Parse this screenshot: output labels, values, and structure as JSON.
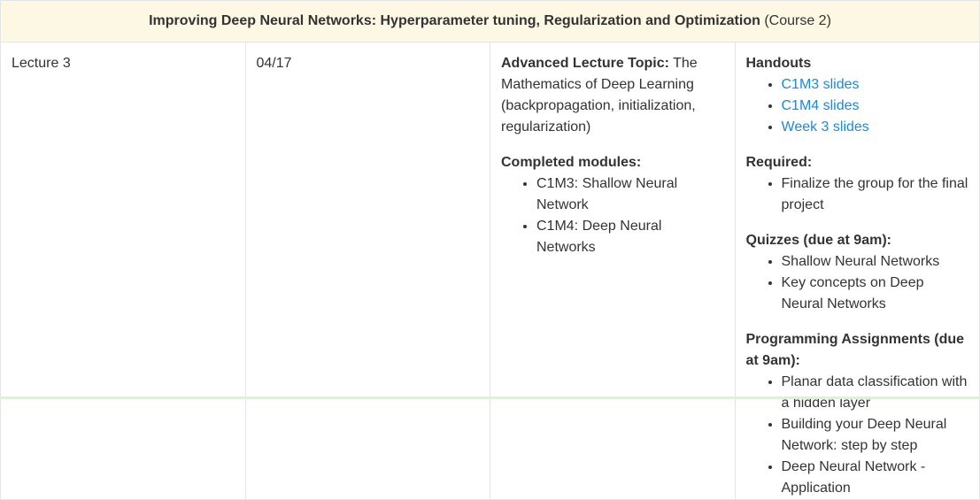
{
  "header": {
    "course_title": "Improving Deep Neural Networks: Hyperparameter tuning, Regularization and Optimization",
    "course_suffix": " (Course 2)"
  },
  "row": {
    "lecture": "Lecture 3",
    "date": "04/17",
    "topic": {
      "label": "Advanced Lecture Topic:",
      "text": " The Mathematics of Deep Learning (backpropagation, initialization, regularization)",
      "completed_label": "Completed modules:",
      "completed": [
        "C1M3: Shallow Neural Network",
        "C1M4: Deep Neural Networks"
      ]
    },
    "materials": {
      "handouts_label": "Handouts",
      "handouts": [
        "C1M3 slides",
        "C1M4 slides",
        "Week 3 slides"
      ],
      "required_label": "Required:",
      "required": [
        "Finalize the group for the final project"
      ],
      "quizzes_label": "Quizzes (due at 9am):",
      "quizzes": [
        "Shallow Neural Networks",
        "Key concepts on Deep Neural Networks"
      ],
      "assignments_label": "Programming Assignments (due at 9am):",
      "assignments": [
        "Planar data classification with a hidden layer",
        "Building your Deep Neural Network: step by step",
        "Deep Neural Network - Application"
      ]
    }
  },
  "colors": {
    "header_bg": "#fcf8e3",
    "link": "#1a8ad9",
    "border": "#e5e5e5"
  }
}
